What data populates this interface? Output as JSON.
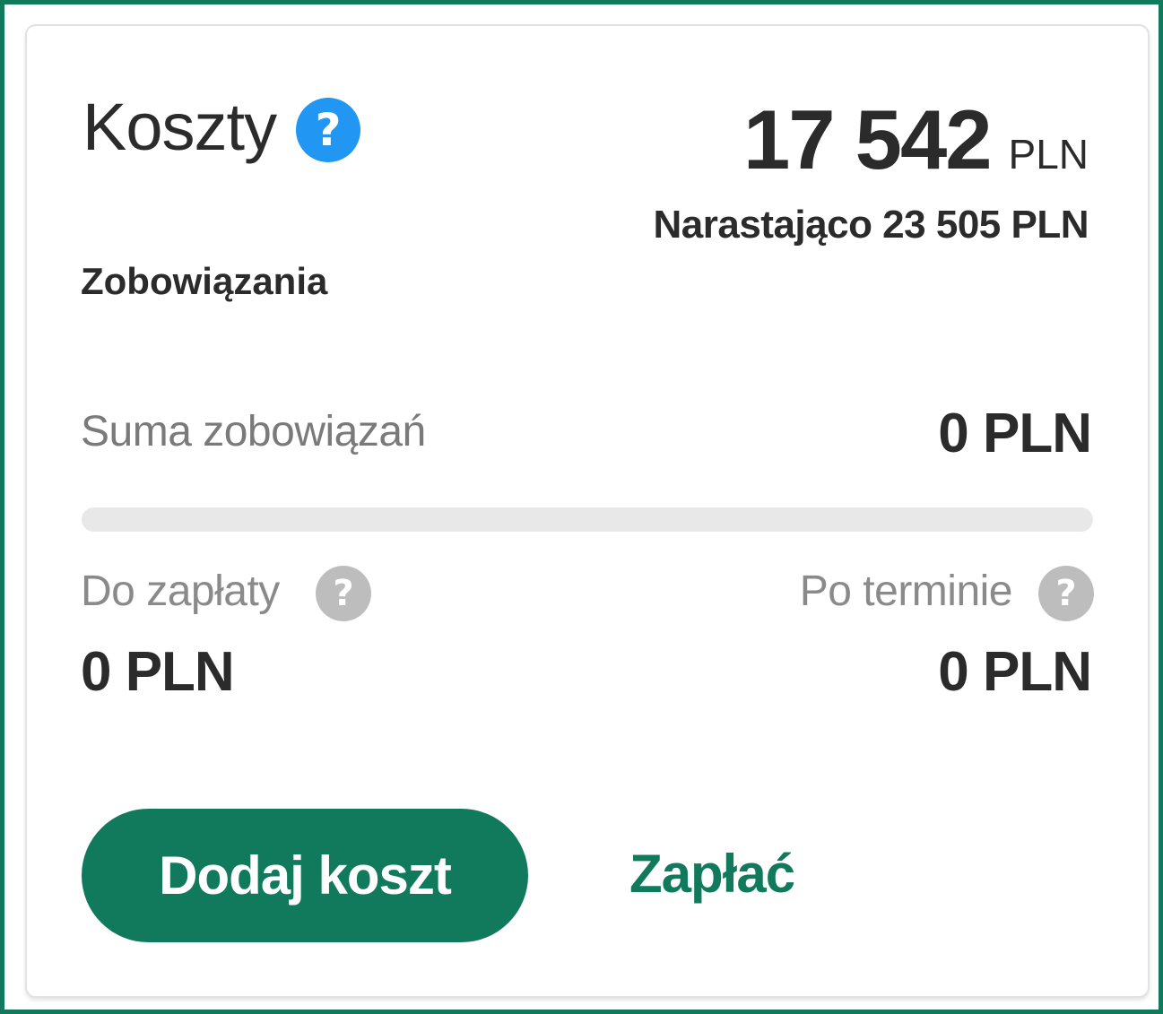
{
  "card": {
    "title": "Koszty",
    "title_help_icon": "question-circle-icon",
    "amount": "17 542",
    "amount_unit": "PLN",
    "cumulative": "Narastająco 23 505 PLN"
  },
  "liabilities": {
    "section_label": "Zobowiązania",
    "sum_label": "Suma zobowiązań",
    "sum_value": "0 PLN",
    "progress_fraction": 0,
    "due_label": "Do zapłaty",
    "due_value": "0 PLN",
    "overdue_label": "Po terminie",
    "overdue_value": "0 PLN",
    "help_icon": "question-circle-icon"
  },
  "actions": {
    "add_cost_label": "Dodaj koszt",
    "pay_label": "Zapłać"
  },
  "colors": {
    "accent": "#117a5c",
    "help_blue": "#2196f3",
    "help_grey": "#bdbdbd",
    "text": "#2b2b2b",
    "muted": "#7a7a7a",
    "track": "#e8e8e8"
  }
}
